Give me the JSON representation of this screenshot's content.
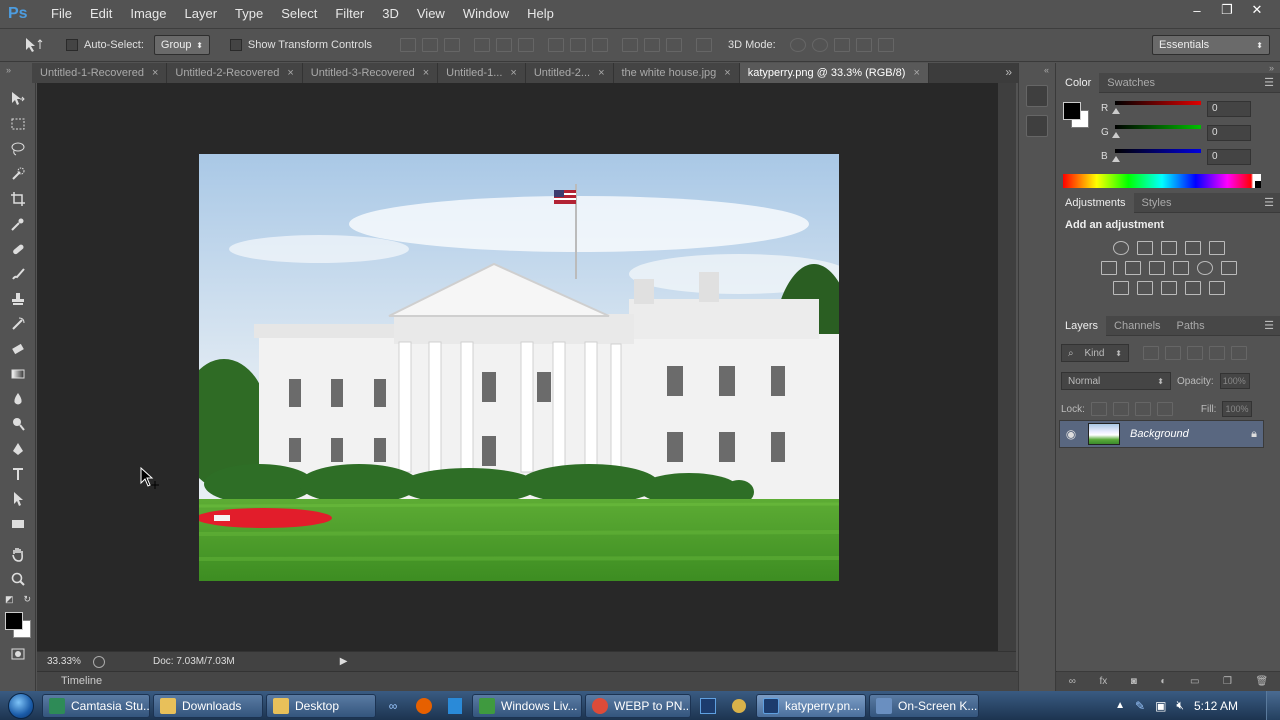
{
  "app": {
    "logo": "Ps",
    "menu": [
      "File",
      "Edit",
      "Image",
      "Layer",
      "Type",
      "Select",
      "Filter",
      "3D",
      "View",
      "Window",
      "Help"
    ],
    "window_controls": [
      "–",
      "❐",
      "✕"
    ]
  },
  "options": {
    "auto_select_label": "Auto-Select:",
    "auto_select_value": "Group",
    "show_transform_label": "Show Transform Controls",
    "mode_3d_label": "3D Mode:",
    "workspace": "Essentials"
  },
  "tabs": [
    {
      "label": "Untitled-1-Recovered"
    },
    {
      "label": "Untitled-2-Recovered"
    },
    {
      "label": "Untitled-3-Recovered"
    },
    {
      "label": "Untitled-1..."
    },
    {
      "label": "Untitled-2..."
    },
    {
      "label": "the white house.jpg"
    },
    {
      "label": "katyperry.png @ 33.3% (RGB/8)"
    }
  ],
  "tab_close": "×",
  "tab_more": "»",
  "status": {
    "zoom": "33.33%",
    "doc_size": "Doc: 7.03M/7.03M",
    "arrow": "▶"
  },
  "timeline": "Timeline",
  "color_panel": {
    "tabs": [
      "Color",
      "Swatches"
    ],
    "channels": [
      {
        "label": "R",
        "value": "0",
        "color": "#e00000"
      },
      {
        "label": "G",
        "value": "0",
        "color": "#00c000"
      },
      {
        "label": "B",
        "value": "0",
        "color": "#0000e0"
      }
    ]
  },
  "adjustments_panel": {
    "tabs": [
      "Adjustments",
      "Styles"
    ],
    "title": "Add an adjustment"
  },
  "layers_panel": {
    "tabs": [
      "Layers",
      "Channels",
      "Paths"
    ],
    "kind": "Kind",
    "blend_mode": "Normal",
    "opacity_label": "Opacity:",
    "opacity_value": "100%",
    "lock_label": "Lock:",
    "fill_label": "Fill:",
    "fill_value": "100%",
    "layer_name": "Background"
  },
  "taskbar": {
    "items": [
      {
        "label": "Camtasia Stu...",
        "icon": "camtasia-icon",
        "color": "#2e8b57"
      },
      {
        "label": "Downloads",
        "icon": "folder-icon",
        "color": "#e8c05a"
      },
      {
        "label": "Desktop",
        "icon": "folder-icon",
        "color": "#e8c05a"
      },
      {
        "label": "Windows Liv...",
        "icon": "windows-live-icon",
        "color": "#3f9a3f"
      },
      {
        "label": "WEBP to PN...",
        "icon": "chrome-icon",
        "color": "#dd4b39"
      },
      {
        "label": "katyperry.pn...",
        "icon": "photoshop-icon",
        "color": "#1c3c6e"
      },
      {
        "label": "On-Screen K...",
        "icon": "keyboard-icon",
        "color": "#6a8fc0"
      }
    ],
    "time": "5:12 AM"
  }
}
